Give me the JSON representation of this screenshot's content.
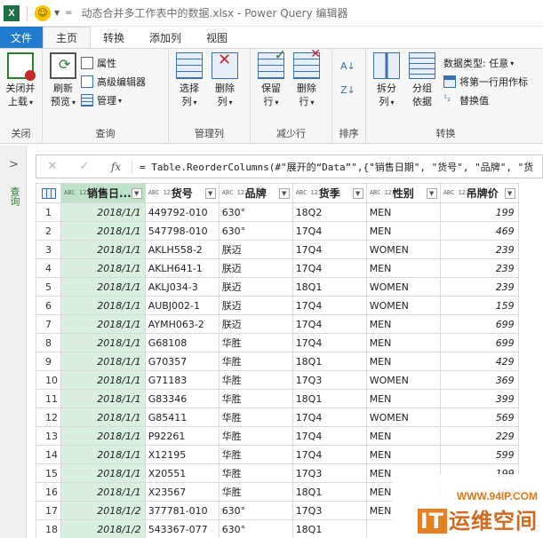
{
  "titlebar": {
    "app_icon": "excel-icon",
    "title": "动态合并多工作表中的数据.xlsx - Power Query 编辑器"
  },
  "tabs": [
    {
      "label": "文件"
    },
    {
      "label": "主页"
    },
    {
      "label": "转换"
    },
    {
      "label": "添加列"
    },
    {
      "label": "视图"
    }
  ],
  "ribbon": {
    "close": {
      "label1": "关闭并",
      "label2": "上载",
      "group": "关闭"
    },
    "query": {
      "refresh1": "刷新",
      "refresh2": "预览",
      "properties": "属性",
      "advanced_editor": "高级编辑器",
      "manage": "管理",
      "group": "查询"
    },
    "manage_cols": {
      "choose1": "选择",
      "choose2": "列",
      "remove1": "删除",
      "remove2": "列",
      "group": "管理列"
    },
    "reduce_rows": {
      "keep1": "保留",
      "keep2": "行",
      "remove1": "删除",
      "remove2": "行",
      "group": "减少行"
    },
    "sort": {
      "group": "排序"
    },
    "transform": {
      "split1": "拆分",
      "split2": "列",
      "group1": "分组",
      "group2": "依据",
      "data_type": "数据类型: 任意",
      "first_row_header": "将第一行用作标",
      "replace": "替换值",
      "group": "转换"
    }
  },
  "nav": {
    "label": "查询"
  },
  "formula": {
    "fx": "fx",
    "text": "= Table.ReorderColumns(#\"展开的“Data”\",{\"销售日期\", \"货号\", \"品牌\", \"货"
  },
  "columns": [
    {
      "name": "销售日...",
      "type": "ABC 123"
    },
    {
      "name": "货号",
      "type": "ABC 123"
    },
    {
      "name": "品牌",
      "type": "ABC 123"
    },
    {
      "name": "货季",
      "type": "ABC 123"
    },
    {
      "name": "性别",
      "type": "ABC 123"
    },
    {
      "name": "吊牌价",
      "type": "ABC 123"
    }
  ],
  "rows": [
    [
      "1",
      "2018/1/1",
      "449792-010",
      "630°",
      "18Q2",
      "MEN",
      "199"
    ],
    [
      "2",
      "2018/1/1",
      "547798-010",
      "630°",
      "17Q4",
      "MEN",
      "469"
    ],
    [
      "3",
      "2018/1/1",
      "AKLH558-2",
      "朕迈",
      "17Q4",
      "WOMEN",
      "239"
    ],
    [
      "4",
      "2018/1/1",
      "AKLH641-1",
      "朕迈",
      "17Q4",
      "MEN",
      "239"
    ],
    [
      "5",
      "2018/1/1",
      "AKLJ034-3",
      "朕迈",
      "18Q1",
      "WOMEN",
      "239"
    ],
    [
      "6",
      "2018/1/1",
      "AUBJ002-1",
      "朕迈",
      "17Q4",
      "WOMEN",
      "159"
    ],
    [
      "7",
      "2018/1/1",
      "AYMH063-2",
      "朕迈",
      "17Q4",
      "MEN",
      "699"
    ],
    [
      "8",
      "2018/1/1",
      "G68108",
      "华胜",
      "17Q4",
      "MEN",
      "699"
    ],
    [
      "9",
      "2018/1/1",
      "G70357",
      "华胜",
      "18Q1",
      "MEN",
      "429"
    ],
    [
      "10",
      "2018/1/1",
      "G71183",
      "华胜",
      "17Q3",
      "WOMEN",
      "369"
    ],
    [
      "11",
      "2018/1/1",
      "G83346",
      "华胜",
      "18Q1",
      "MEN",
      "399"
    ],
    [
      "12",
      "2018/1/1",
      "G85411",
      "华胜",
      "17Q4",
      "WOMEN",
      "569"
    ],
    [
      "13",
      "2018/1/1",
      "P92261",
      "华胜",
      "17Q4",
      "MEN",
      "229"
    ],
    [
      "14",
      "2018/1/1",
      "X12195",
      "华胜",
      "17Q4",
      "MEN",
      "599"
    ],
    [
      "15",
      "2018/1/1",
      "X20551",
      "华胜",
      "17Q3",
      "MEN",
      "199"
    ],
    [
      "16",
      "2018/1/1",
      "X23567",
      "华胜",
      "18Q1",
      "MEN",
      "199"
    ],
    [
      "17",
      "2018/1/2",
      "377781-010",
      "630°",
      "17Q3",
      "MEN",
      ""
    ],
    [
      "18",
      "2018/1/2",
      "543367-077",
      "630°",
      "18Q1",
      "",
      ""
    ]
  ],
  "watermark": {
    "url": "WWW.94IP.COM",
    "brand_it": "IT",
    "brand_text": "运维空间"
  }
}
